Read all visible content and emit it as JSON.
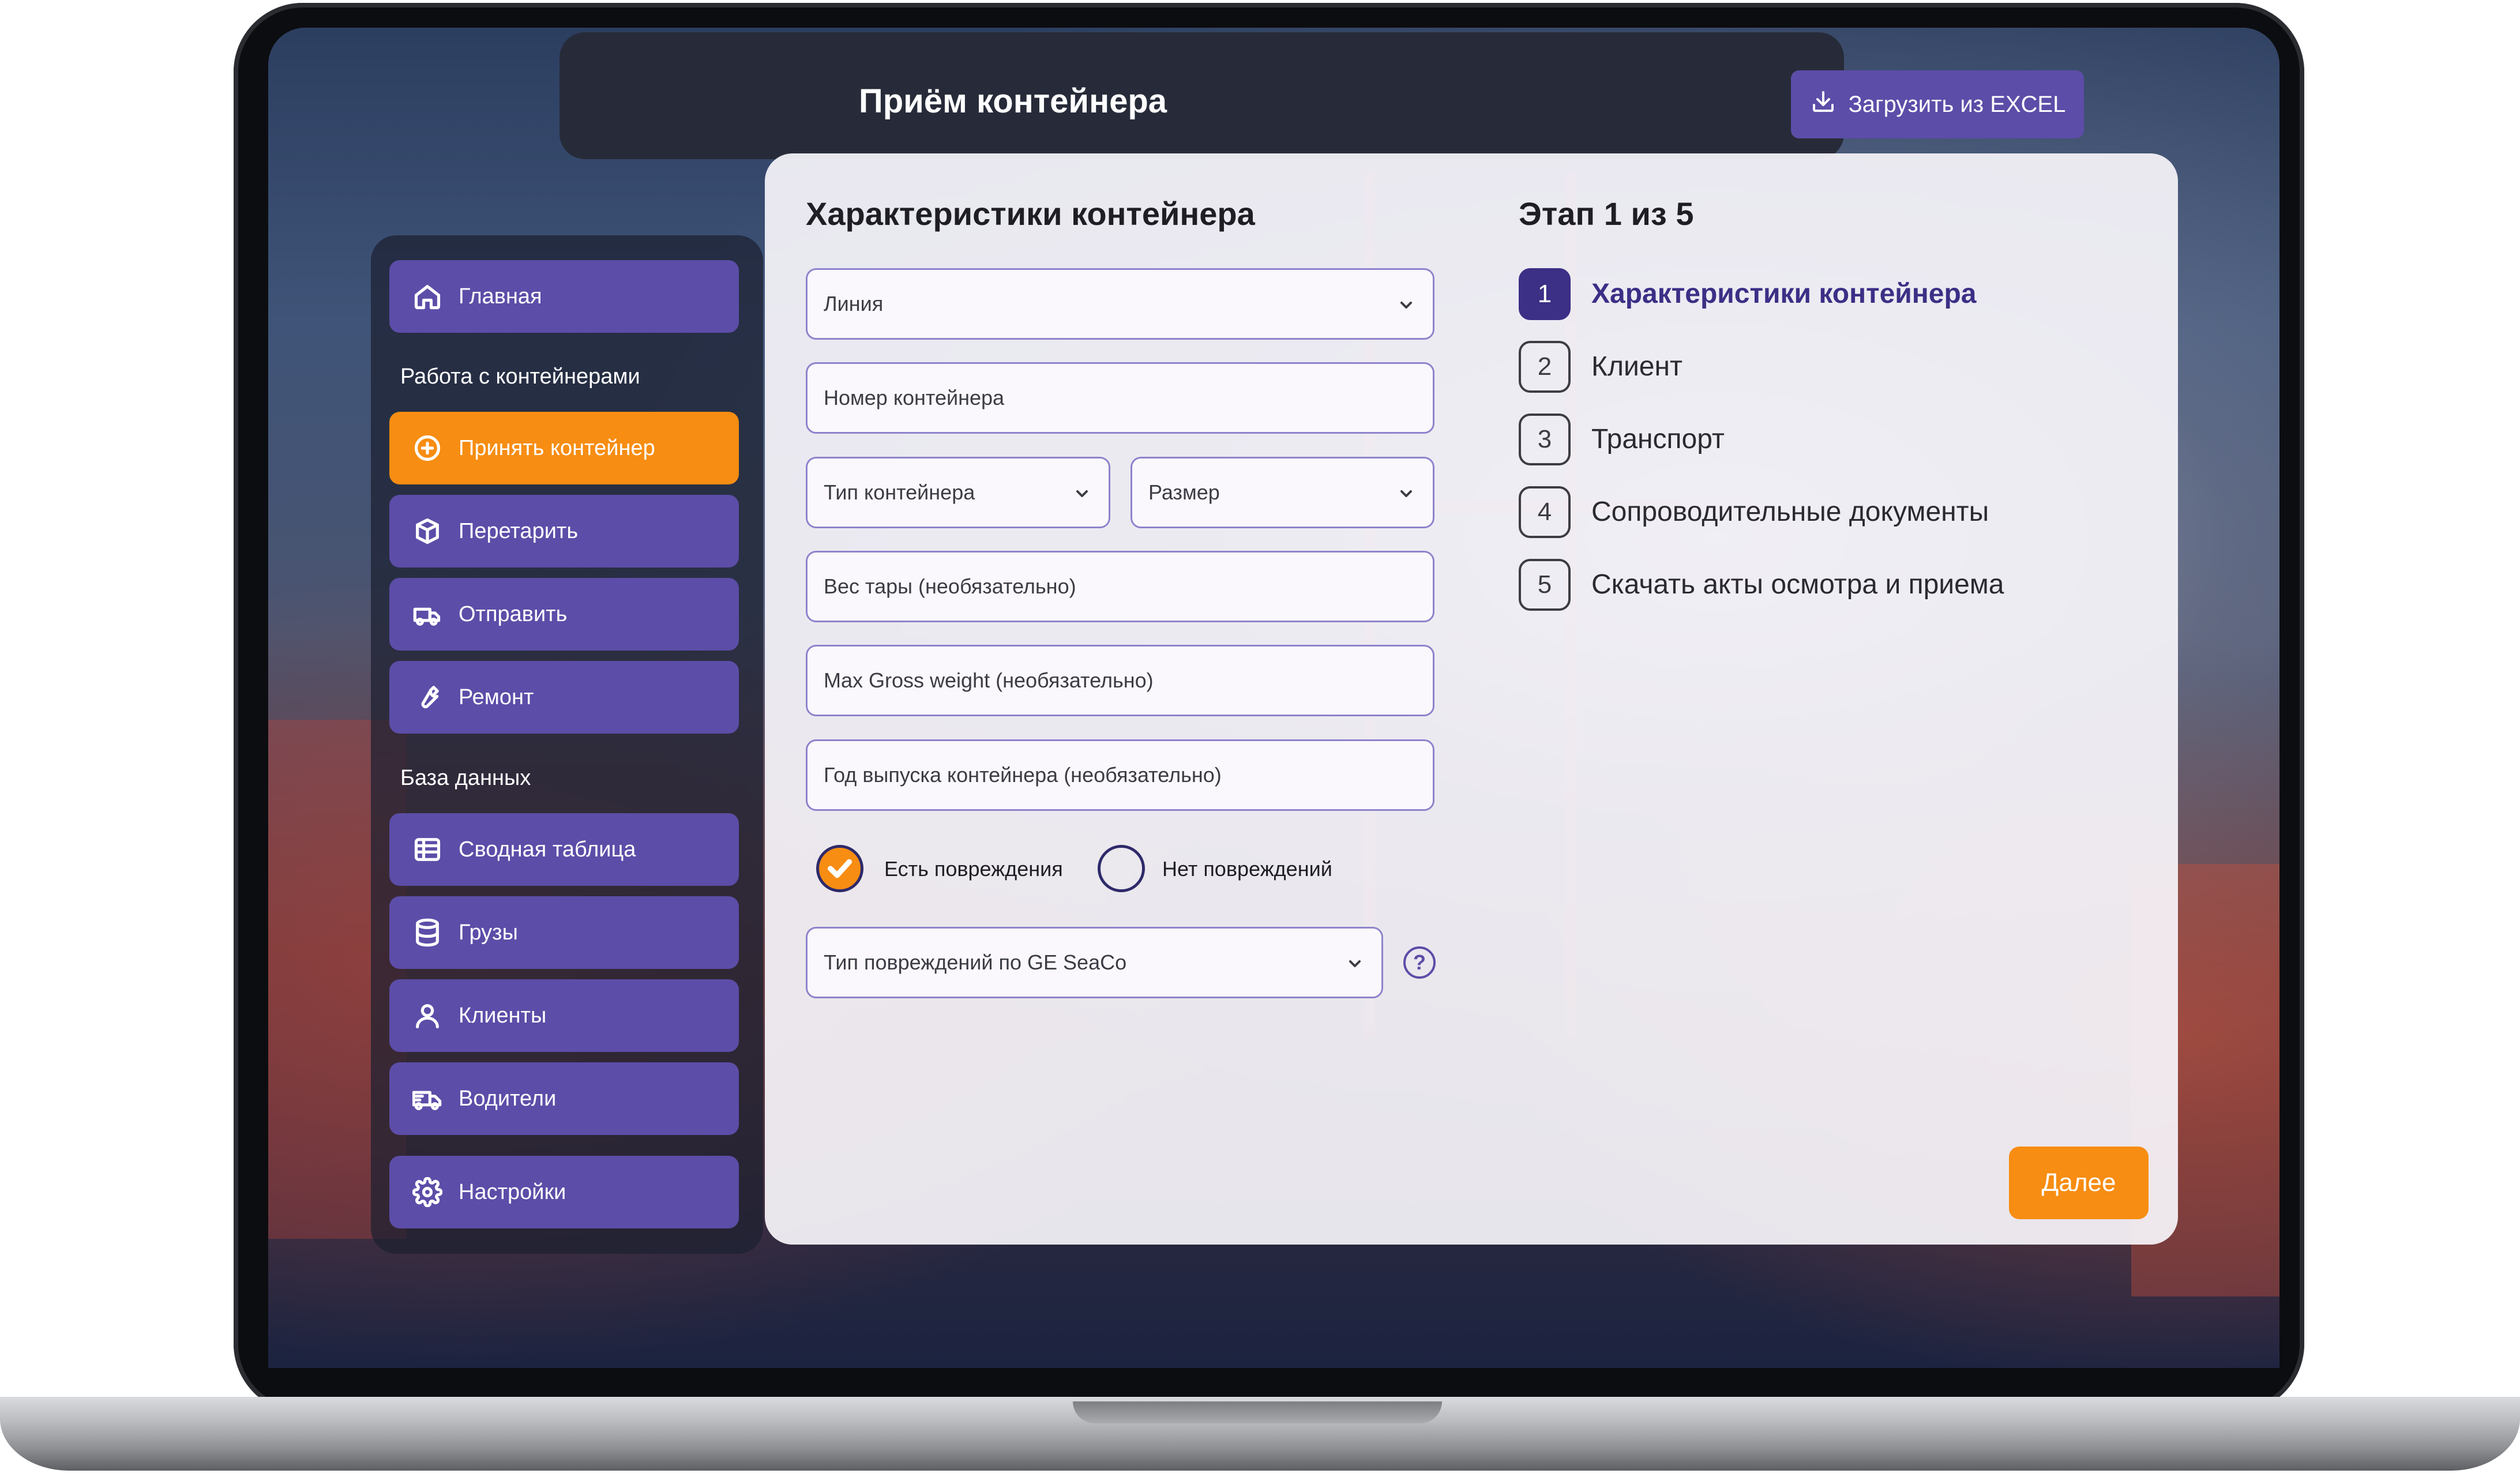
{
  "header": {
    "title": "Приём контейнера",
    "upload_button": "Загрузить из EXCEL"
  },
  "sidebar": {
    "home": "Главная",
    "section_containers": "Работа с контейнерами",
    "accept": "Принять контейнер",
    "retare": "Перетарить",
    "send": "Отправить",
    "repair": "Ремонт",
    "section_database": "База данных",
    "summary": "Сводная таблица",
    "cargo": "Грузы",
    "clients": "Клиенты",
    "drivers": "Водители",
    "settings": "Настройки",
    "active_item": "Принять контейнер"
  },
  "form": {
    "title": "Характеристики контейнера",
    "line_placeholder": "Линия",
    "container_number_placeholder": "Номер контейнера",
    "container_type_placeholder": "Тип контейнера",
    "size_placeholder": "Размер",
    "tare_weight_placeholder": "Вес тары (необязательно)",
    "max_gross_placeholder": "Max Gross weight (необязательно)",
    "year_placeholder": "Год выпуска контейнера (необязательно)",
    "damage_yes": "Есть повреждения",
    "damage_no": "Нет повреждений",
    "damage_selected": "Есть повреждения",
    "damage_type_placeholder": "Тип повреждений по GE SeaCo",
    "help_symbol": "?"
  },
  "stepper": {
    "title": "Этап  1 из 5",
    "current_step": 1,
    "steps": [
      {
        "num": "1",
        "label": "Характеристики контейнера"
      },
      {
        "num": "2",
        "label": "Клиент"
      },
      {
        "num": "3",
        "label": "Транспорт"
      },
      {
        "num": "4",
        "label": "Сопроводительные документы"
      },
      {
        "num": "5",
        "label": "Скачать акты осмотра и приема"
      }
    ]
  },
  "actions": {
    "next": "Далее"
  },
  "colors": {
    "primary": "#5c4da8",
    "accent": "#f78d12",
    "active_step": "#3b2f86",
    "header_bg": "#272b39"
  },
  "icons": {
    "upload": "download-icon",
    "home": "home-icon",
    "accept": "plus-circle-icon",
    "retare": "box-icon",
    "send": "truck-icon",
    "repair": "wrench-icon",
    "summary": "table-icon",
    "cargo": "database-icon",
    "clients": "user-icon",
    "drivers": "delivery-truck-icon",
    "settings": "gear-icon"
  }
}
